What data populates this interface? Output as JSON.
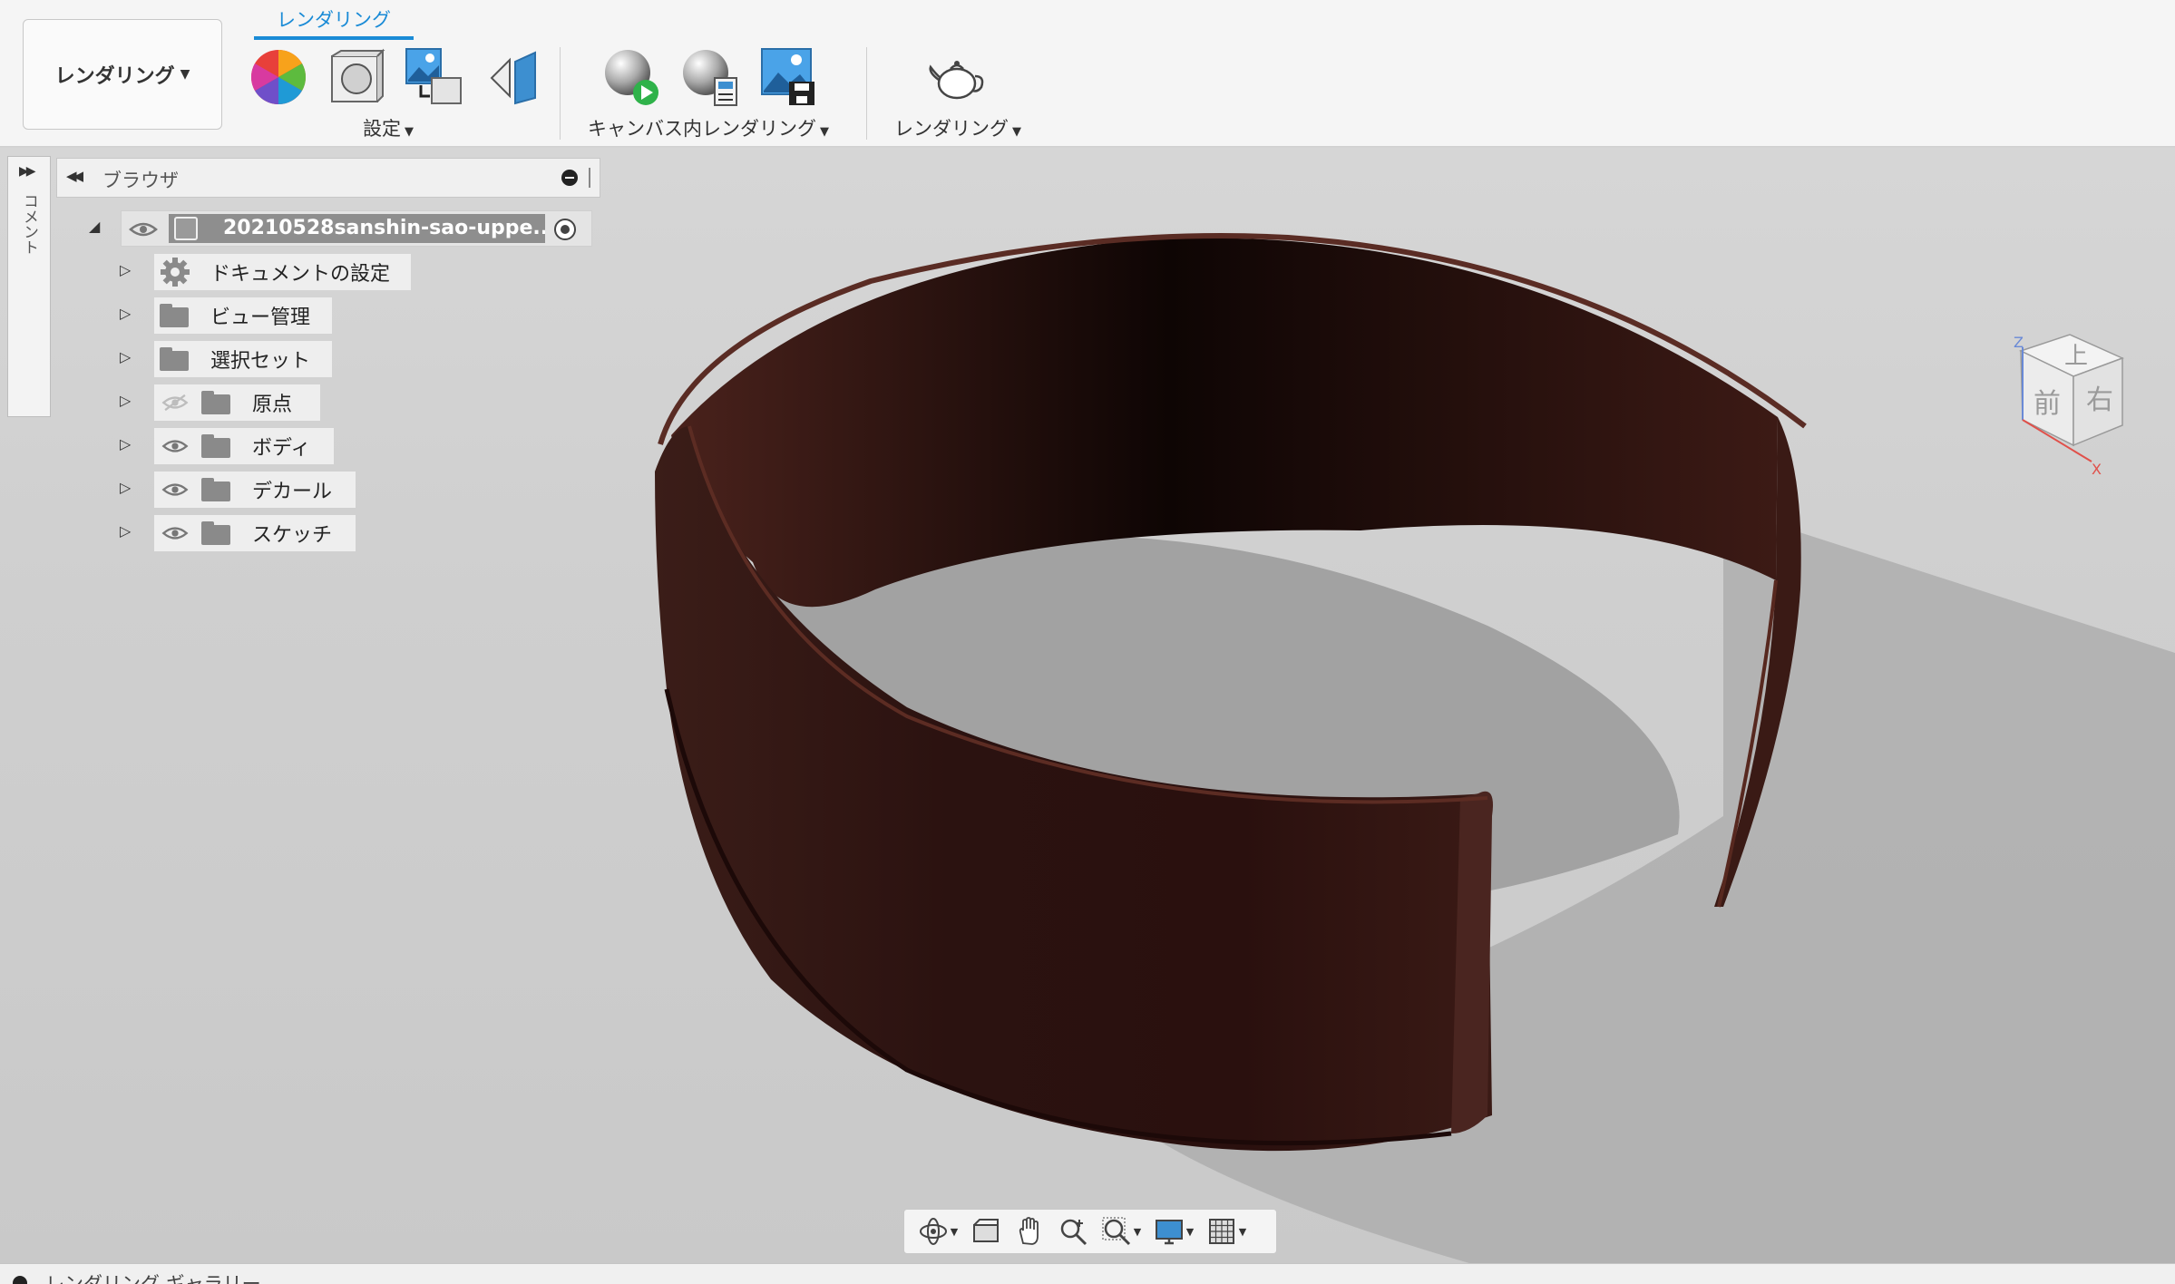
{
  "toolbar": {
    "workspace_label": "レンダリング",
    "active_tab": "レンダリング",
    "groups": {
      "setup_label": "設定",
      "in_canvas_label": "キャンバス内レンダリング",
      "render_label": "レンダリング"
    },
    "icons": [
      "appearance-icon",
      "scene-settings-icon",
      "texture-map-icon",
      "decal-icon",
      "in-canvas-render-icon",
      "in-canvas-render-settings-icon",
      "capture-image-icon",
      "render-teapot-icon"
    ]
  },
  "comments_panel": {
    "label": "コメント"
  },
  "browser": {
    "title": "ブラウザ",
    "root": {
      "label": "20210528sanshin-sao-uppe..."
    },
    "items": [
      {
        "label": "ドキュメントの設定",
        "icon": "gear-icon",
        "eye": "none"
      },
      {
        "label": "ビュー管理",
        "icon": "folder-icon",
        "eye": "none"
      },
      {
        "label": "選択セット",
        "icon": "folder-icon",
        "eye": "none"
      },
      {
        "label": "原点",
        "icon": "folder-icon",
        "eye": "hidden"
      },
      {
        "label": "ボディ",
        "icon": "folder-icon",
        "eye": "visible"
      },
      {
        "label": "デカール",
        "icon": "folder-icon",
        "eye": "visible"
      },
      {
        "label": "スケッチ",
        "icon": "folder-icon",
        "eye": "visible"
      }
    ]
  },
  "viewcube": {
    "top": "上",
    "front": "前",
    "right": "右",
    "axis_z": "Z",
    "axis_x": "X"
  },
  "navbar": {
    "icons": [
      "orbit-icon",
      "look-at-icon",
      "pan-icon",
      "zoom-icon",
      "fit-icon",
      "display-settings-icon",
      "grid-icon"
    ]
  },
  "bottom_bar": {
    "label": "レンダリング ギャラリー"
  },
  "colors": {
    "accent": "#1a8bd6",
    "model": "#3a1a16",
    "viewport_bg": "#d0d0d0"
  }
}
